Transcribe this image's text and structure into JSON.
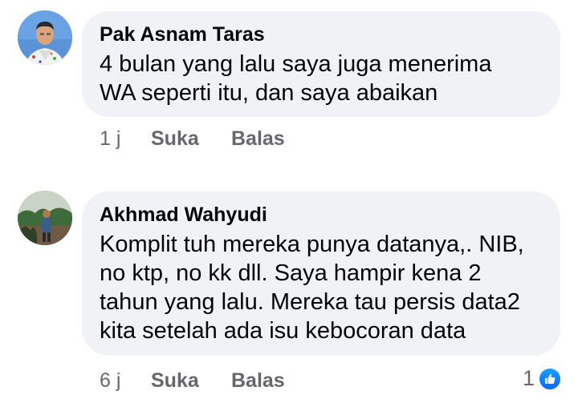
{
  "comments": [
    {
      "author": "Pak Asnam Taras",
      "text": "4 bulan yang lalu saya juga menerima\nWA seperti itu, dan saya abaikan",
      "time": "1 j",
      "like_label": "Suka",
      "reply_label": "Balas"
    },
    {
      "author": "Akhmad Wahyudi",
      "text": "Komplit tuh mereka punya datanya,. NIB,\nno ktp, no kk dll. Saya hampir kena 2\ntahun yang lalu. Mereka tau persis data2\nkita setelah ada isu kebocoran data",
      "time": "6 j",
      "like_label": "Suka",
      "reply_label": "Balas",
      "reaction_count": "1",
      "reaction_icon": "thumbs-up-icon"
    }
  ],
  "colors": {
    "bubble": "#f0f2f5",
    "secondary_text": "#65676b",
    "like_blue": "#0866ff"
  }
}
